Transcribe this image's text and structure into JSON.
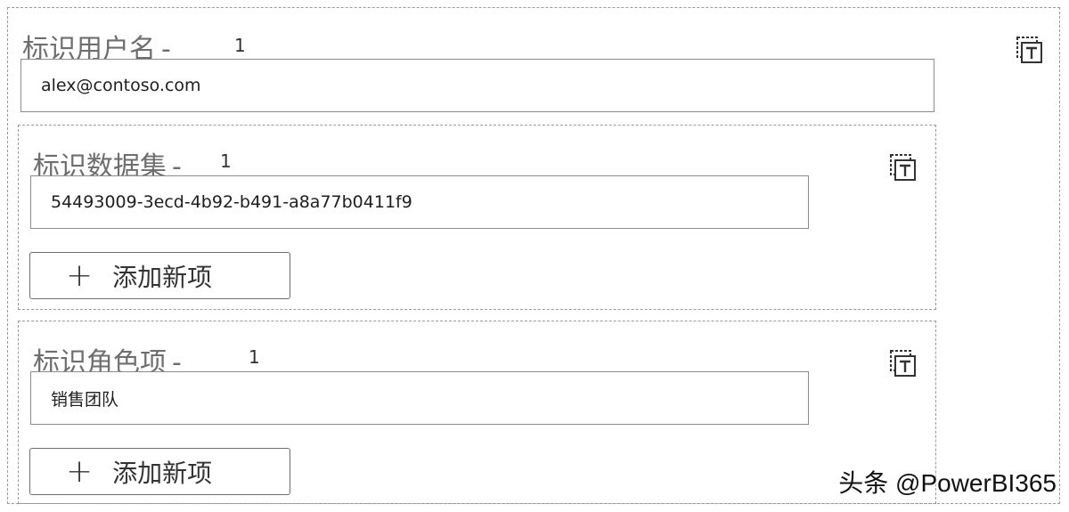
{
  "username_field": {
    "label": "标识用户名",
    "dash": "-",
    "index": "1",
    "value": "alex@contoso.com"
  },
  "dataset_group": {
    "label": "标识数据集",
    "dash": "-",
    "index": "1",
    "value": "54493009-3ecd-4b92-b491-a8a77b0411f9",
    "add_label": "添加新项"
  },
  "role_group": {
    "label": "标识角色项",
    "dash": "-",
    "index": "1",
    "value": "销售团队",
    "add_label": "添加新项"
  },
  "icons": {
    "text_control": "text-control-icon",
    "plus": "plus-icon"
  },
  "watermark": "头条 @PowerBI365"
}
